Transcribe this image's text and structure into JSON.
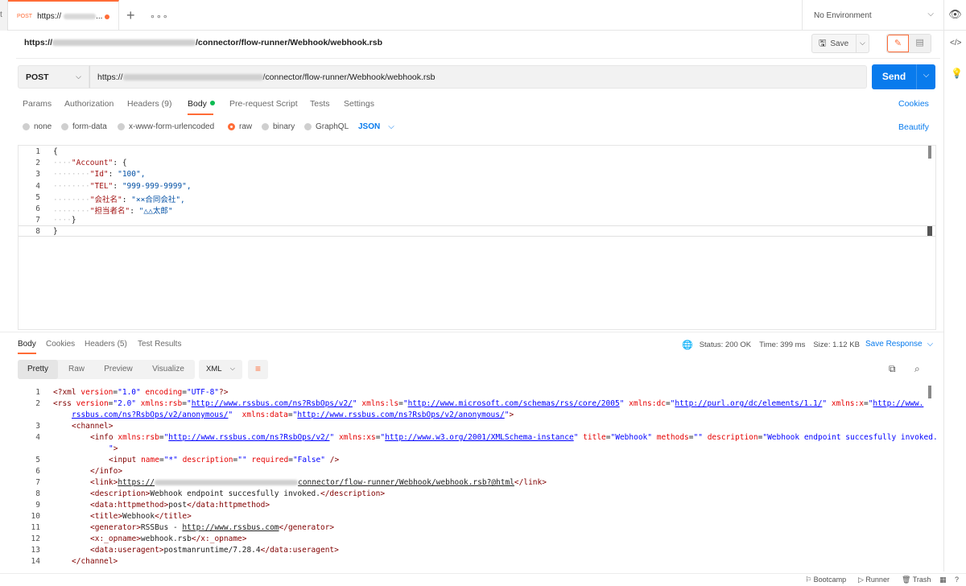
{
  "tabbar": {
    "left_stub": "t",
    "tab_method": "POST",
    "tab_name": "https://",
    "tab_ellipsis": "...",
    "plus": "+",
    "more": "∘∘∘",
    "environment": "No Environment"
  },
  "request": {
    "title_prefix": "https://",
    "title_suffix": "/connector/flow-runner/Webhook/webhook.rsb",
    "save_label": "Save",
    "method": "POST",
    "url_prefix": "https://",
    "url_suffix": "/connector/flow-runner/Webhook/webhook.rsb",
    "send_label": "Send"
  },
  "request_tabs": {
    "params": "Params",
    "authorization": "Authorization",
    "headers": "Headers (9)",
    "body": "Body",
    "prerequest": "Pre-request Script",
    "tests": "Tests",
    "settings": "Settings",
    "cookies": "Cookies"
  },
  "body_types": {
    "none": "none",
    "form_data": "form-data",
    "urlencoded": "x-www-form-urlencoded",
    "raw": "raw",
    "binary": "binary",
    "graphql": "GraphQL",
    "format": "JSON",
    "selected": "raw",
    "beautify": "Beautify"
  },
  "request_body": {
    "line_numbers": [
      "1",
      "2",
      "3",
      "4",
      "5",
      "6",
      "7",
      "8"
    ],
    "lines": [
      {
        "guide": "",
        "key": "",
        "sep": "",
        "text": "{"
      },
      {
        "guide": "····",
        "key": "\"Account\"",
        "sep": ": ",
        "text": "{"
      },
      {
        "guide": "········",
        "key": "\"Id\"",
        "sep": ": ",
        "text": "\"100\","
      },
      {
        "guide": "········",
        "key": "\"TEL\"",
        "sep": ": ",
        "text": "\"999-999-9999\","
      },
      {
        "guide": "········",
        "key": "\"会社名\"",
        "sep": ": ",
        "text": "\"××合同会社\","
      },
      {
        "guide": "········",
        "key": "\"担当者名\"",
        "sep": ": ",
        "text": "\"△△太郎\""
      },
      {
        "guide": "····",
        "key": "",
        "sep": "",
        "text": "}"
      },
      {
        "guide": "",
        "key": "",
        "sep": "",
        "text": "}"
      }
    ]
  },
  "response_tabs": {
    "body": "Body",
    "cookies": "Cookies",
    "headers": "Headers (5)",
    "test_results": "Test Results"
  },
  "response_status": {
    "status": "Status: 200 OK",
    "time": "Time: 399 ms",
    "size": "Size: 1.12 KB",
    "save_response": "Save Response"
  },
  "response_view": {
    "pretty": "Pretty",
    "raw": "Raw",
    "preview": "Preview",
    "visualize": "Visualize",
    "format": "XML"
  },
  "response_body": {
    "line_numbers": [
      "1",
      "2",
      "",
      "3",
      "4",
      "",
      "5",
      "6",
      "7",
      "8",
      "9",
      "10",
      "11",
      "12",
      "13",
      "14"
    ]
  },
  "statusbar": {
    "bootcamp": "Bootcamp",
    "runner": "Runner",
    "trash": "Trash"
  },
  "colors": {
    "accent": "#ff6c37",
    "primary": "#097bed",
    "success": "#0cbb52"
  }
}
